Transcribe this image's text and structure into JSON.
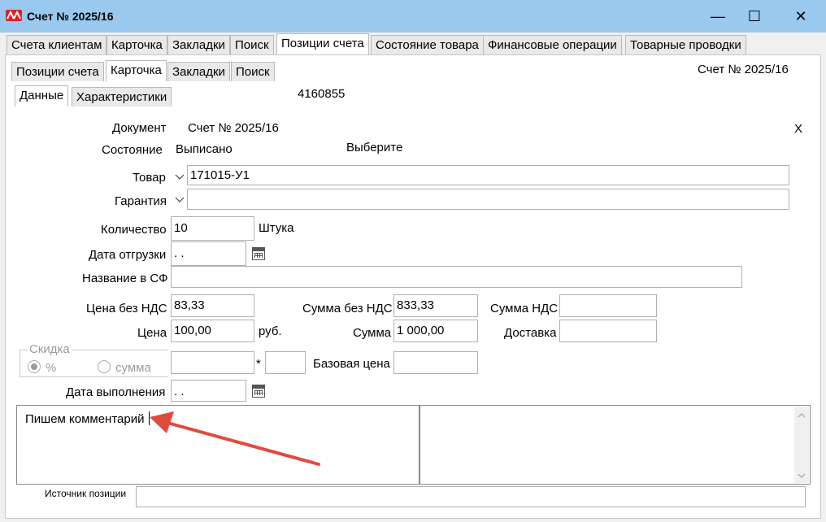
{
  "window": {
    "title": "Счет № 2025/16",
    "minimize": "—",
    "maximize": "☐",
    "close": "✕"
  },
  "main_tabs": [
    "Счета клиентам",
    "Карточка",
    "Закладки",
    "Поиск",
    "Позиции счета",
    "Состояние товара",
    "Финансовые операции",
    "Товарные проводки"
  ],
  "sub_tabs": [
    "Позиции счета",
    "Карточка",
    "Закладки",
    "Поиск"
  ],
  "sub_sub_tabs": [
    "Данные",
    "Характеристики"
  ],
  "header": {
    "invoice_ref": "Счет № 2025/16",
    "id": "4160855",
    "close_x": "X"
  },
  "form": {
    "document_label": "Документ",
    "document_value": "Счет № 2025/16",
    "state_label": "Состояние",
    "state_value": "Выписано",
    "choose": "Выберите",
    "product_label": "Товар",
    "product_value": "171015-У1",
    "warranty_label": "Гарантия",
    "warranty_value": "",
    "quantity_label": "Количество",
    "quantity_value": "10",
    "unit": "Штука",
    "ship_date_label": "Дата отгрузки",
    "ship_date_value": " .  .",
    "sf_name_label": "Название в СФ",
    "sf_name_value": "",
    "price_novat_label": "Цена без НДС",
    "price_novat_value": "83,33",
    "sum_novat_label": "Сумма без НДС",
    "sum_novat_value": "833,33",
    "vat_sum_label": "Сумма НДС",
    "vat_sum_value": "",
    "price_label": "Цена",
    "price_value": "100,00",
    "currency": "руб.",
    "sum_label": "Сумма",
    "sum_value": "1 000,00",
    "delivery_label": "Доставка",
    "delivery_value": "",
    "discount_group": "Скидка",
    "discount_percent": "%",
    "discount_sum": "сумма",
    "discount_value": "",
    "multiply": "*",
    "multiplier_value": "",
    "base_price_label": "Базовая цена",
    "base_price_value": "",
    "done_date_label": "Дата выполнения",
    "done_date_value": " .  .",
    "comment": "Пишем комментарий",
    "source_label": "Источник позиции",
    "source_value": ""
  }
}
